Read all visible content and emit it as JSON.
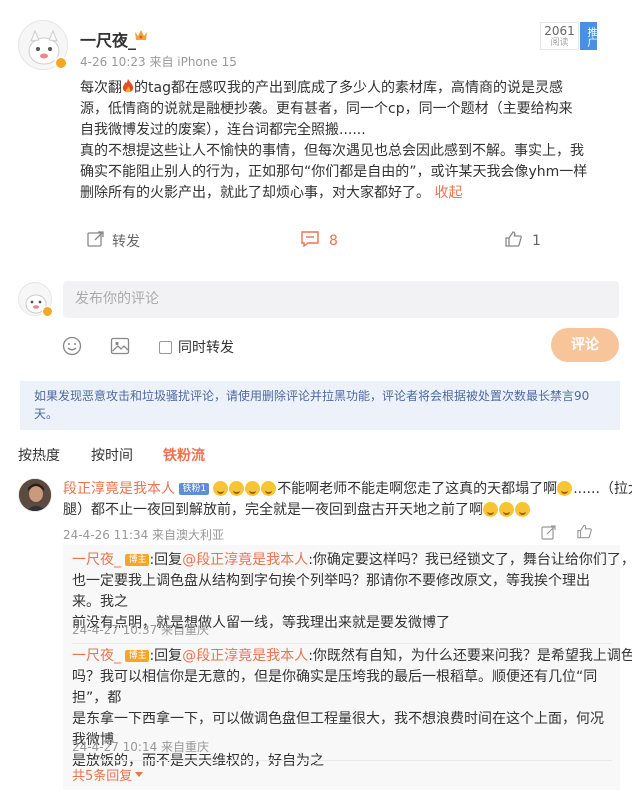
{
  "post": {
    "author": "一尺夜_",
    "meta": "4-26 10:23  来自 iPhone 15",
    "read_count": "2061",
    "read_label": "阅读",
    "promote_label": "推广",
    "body_line1_a": "每次翻",
    "body_line1_b": "的tag都在感叹我的产出到底成了多少人的素材库，高情商的说是灵感",
    "body_line2": "源，低情商的说就是融梗抄袭。更有甚者，同一个cp，同一个题材（主要给构来",
    "body_line3": "自我微博发过的废案），连台词都完全照搬......",
    "body_line4": "真的不想提这些让人不愉快的事情，但每次遇见也总会因此感到不解。事实上，我",
    "body_line5": "确实不能阻止别人的行为，正如那句“你们都是自由的”，或许某天我会像yhm一样",
    "body_line6": "删除所有的火影产出，就此了却烦心事，对大家都好了。",
    "collapse_label": "收起",
    "actions": {
      "forward_label": "转发",
      "comment_count": "8",
      "like_count": "1"
    }
  },
  "composer": {
    "placeholder": "发布你的评论",
    "also_forward_label": "同时转发",
    "submit_label": "评论"
  },
  "notice": {
    "line1": "如果发现恶意攻击和垃圾骚扰评论，请使用删除评论并拉黑功能，评论者将会根据被处置次数最长禁言90",
    "line2": "天。"
  },
  "tabs": [
    "按热度",
    "按时间",
    "铁粉流"
  ],
  "comment": {
    "author": "段正淳竟是我本人",
    "fan_badge": "铁粉1",
    "line1_tail": "不能啊老师不能走啊您走了这真的天都塌了啊",
    "line1_end": "......（拉大",
    "line2": "腿）都不止一夜回到解放前，完全就是一夜回到盘古开天地之前了啊",
    "meta": "24-4-26 11:34  来自澳大利亚",
    "replies": [
      {
        "author": "一尺夜_",
        "badge": "博主",
        "prefix": ":回复",
        "mention": "@段正淳竟是我本人",
        "line1": ":你确定要这样吗？我已经锁文了，舞台让给你们了，你",
        "line2": "也一定要我上调色盘从结构到字句挨个列举吗？那请你不要修改原文，等我挨个理出来。我之",
        "line3": "前没有点明，就是想做人留一线，等我理出来就是要发微博了",
        "meta": "24-4-27 10:37  来自重庆"
      },
      {
        "author": "一尺夜_",
        "badge": "博主",
        "prefix": ":回复",
        "mention": "@段正淳竟是我本人",
        "line1": ":你既然有自知，为什么还要来问我？是希望我上调色盘",
        "line2": "吗？我可以相信你是无意的，但是你确实是压垮我的最后一根稻草。顺便还有几位“同担”，都",
        "line3": "是东拿一下西拿一下，可以做调色盘但工程量很大，我不想浪费时间在这个上面，何况我微博",
        "line4": "是放饭的，而不是天天维权的，好自为之",
        "meta": "24-4-27 10:14  来自重庆"
      }
    ],
    "more_replies_label": "共5条回复"
  }
}
